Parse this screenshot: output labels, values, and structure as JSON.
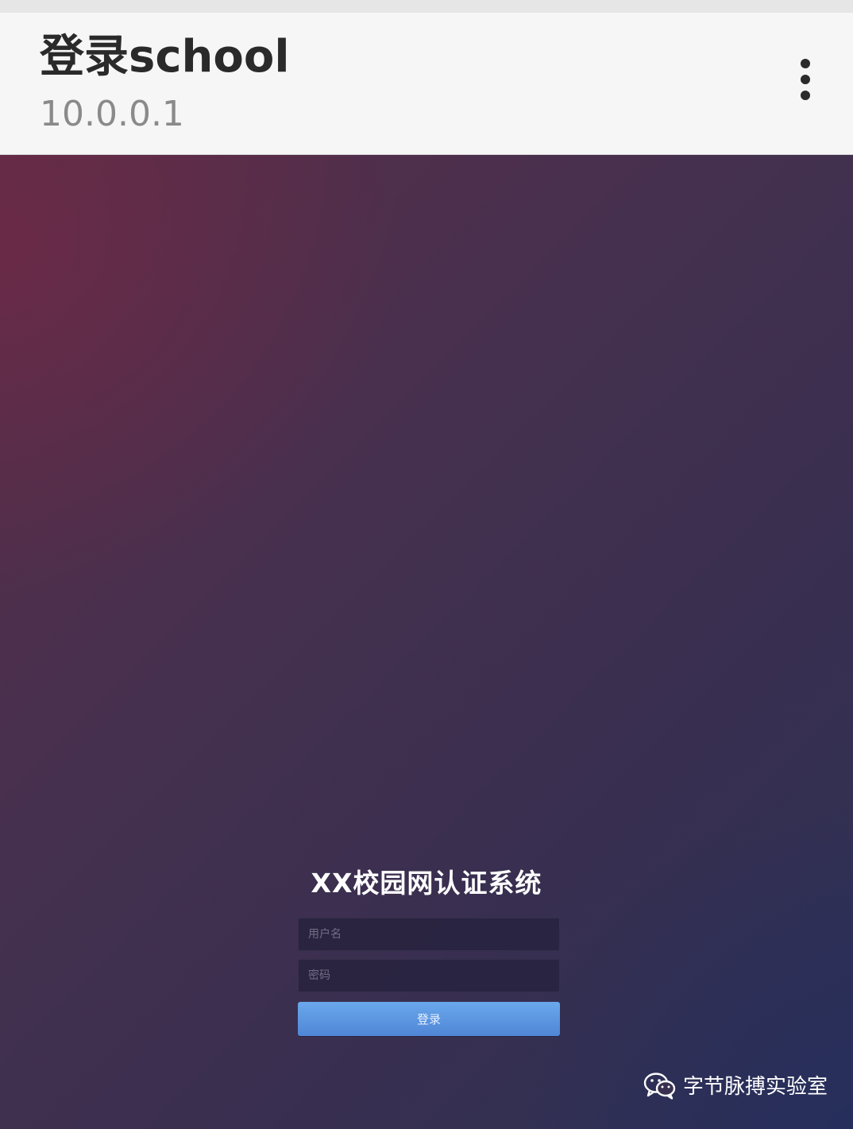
{
  "app_bar": {
    "title": "登录school",
    "subtitle": "10.0.0.1",
    "menu_icon": "more-vert-icon"
  },
  "login": {
    "title": "XX校园网认证系统",
    "username_placeholder": "用户名",
    "password_placeholder": "密码",
    "submit_label": "登录"
  },
  "watermark": {
    "icon": "wechat-icon",
    "text": "字节脉搏实验室"
  },
  "colors": {
    "app_bar_bg": "#f6f6f6",
    "button_blue": "#5a94de",
    "bg_magenta": "#5a2d47",
    "bg_navy": "#2c3055"
  }
}
